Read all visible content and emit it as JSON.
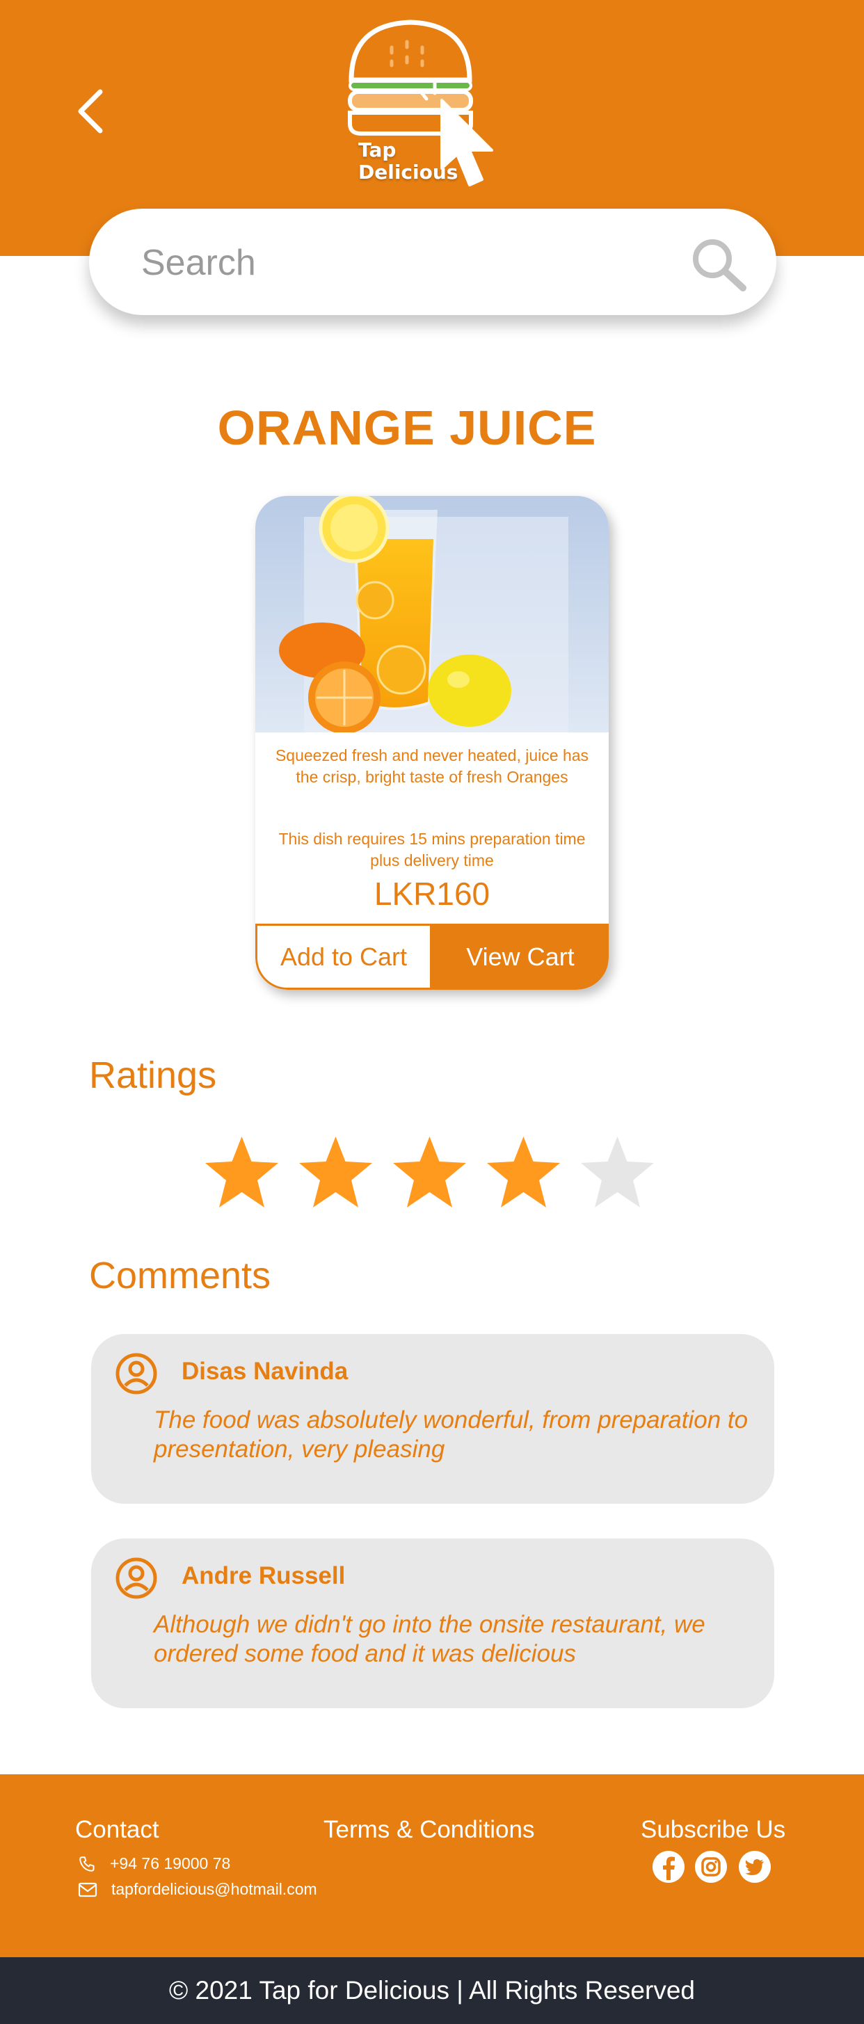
{
  "app": {
    "logo_text_line1": "Tap",
    "logo_text_line2": "Delicious"
  },
  "search": {
    "placeholder": "Search",
    "value": ""
  },
  "product": {
    "title": "ORANGE JUICE",
    "description": "Squeezed fresh and never heated, juice has the crisp, bright taste of fresh Oranges",
    "preparation": "This dish requires 15 mins preparation time plus delivery time",
    "price": "LKR160",
    "add_to_cart_label": "Add to Cart",
    "view_cart_label": "View Cart"
  },
  "ratings": {
    "title": "Ratings",
    "value": 4,
    "max": 5
  },
  "comments": {
    "title": "Comments",
    "items": [
      {
        "author": "Disas Navinda",
        "text": "The food was absolutely wonderful, from preparation to presentation, very pleasing"
      },
      {
        "author": "Andre Russell",
        "text": "Although we didn't go into the onsite restaurant, we ordered some food and it was delicious"
      }
    ]
  },
  "footer": {
    "contact_title": "Contact",
    "terms_label": "Terms & Conditions",
    "subscribe_title": "Subscribe Us",
    "phone": "+94 76 19000 78",
    "email": "tapfordelicious@hotmail.com",
    "social_icons": [
      "facebook-icon",
      "instagram-icon",
      "twitter-icon"
    ],
    "copyright": "© 2021 Tap for Delicious | All Rights Reserved"
  },
  "colors": {
    "accent": "#E67E12",
    "star_filled": "#FF9A1F",
    "star_empty": "#E6E6E6",
    "comment_bg": "#E8E8E8",
    "copyright_bg": "#262A35"
  }
}
